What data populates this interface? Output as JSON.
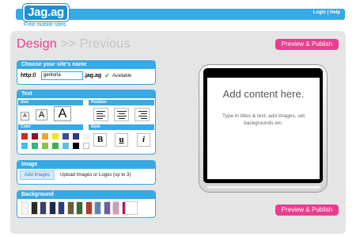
{
  "header": {
    "logo": "Jag.ag",
    "tagline": "Free mobile sites",
    "login": "Login",
    "separator": "|",
    "help": "Help"
  },
  "breadcrumb": {
    "current": "Design",
    "next": ">> Previous"
  },
  "buttons": {
    "preview_publish": "Preview & Publish"
  },
  "site_name_panel": {
    "title": "Choose your site's name",
    "prefix": "http://",
    "value": "gentoria",
    "suffix": ".jag.ag",
    "status": "Available",
    "check": "✔"
  },
  "text_panel": {
    "title": "Text",
    "size_label": "Size",
    "position_label": "Position",
    "color_label": "Color",
    "style_label": "Style",
    "size_options": [
      "A",
      "A",
      "A"
    ],
    "style_options": [
      "B",
      "u",
      "i"
    ],
    "colors": [
      "#d9232b",
      "#9b0f1c",
      "#f3a51c",
      "#fbe214",
      "#3b4a9b",
      "#2b3a86",
      "#f2f2f2",
      "#39c3ef",
      "#34b77a",
      "#89c43f",
      "#3ab34f",
      "#59c0e3",
      "#000000",
      "#ffffff"
    ]
  },
  "image_panel": {
    "title": "Image",
    "button": "Add Images",
    "hint": "Upload Images or Logos (up to 3)"
  },
  "background_panel": {
    "title": "Background",
    "backgrounds": [
      "#f4f4f4",
      "#2a2a2a",
      "#3a3f5c",
      "#1b2a55",
      "#2c3c76",
      "#6b5d38",
      "#3f6b2e",
      "#b43b2d",
      "#5c86b7",
      "#6d5e9f",
      "#d29bb6",
      "#aa1c53"
    ]
  },
  "preview": {
    "headline": "Add content here.",
    "body": "Type in titles & text, add images, set backgrounds etc."
  }
}
